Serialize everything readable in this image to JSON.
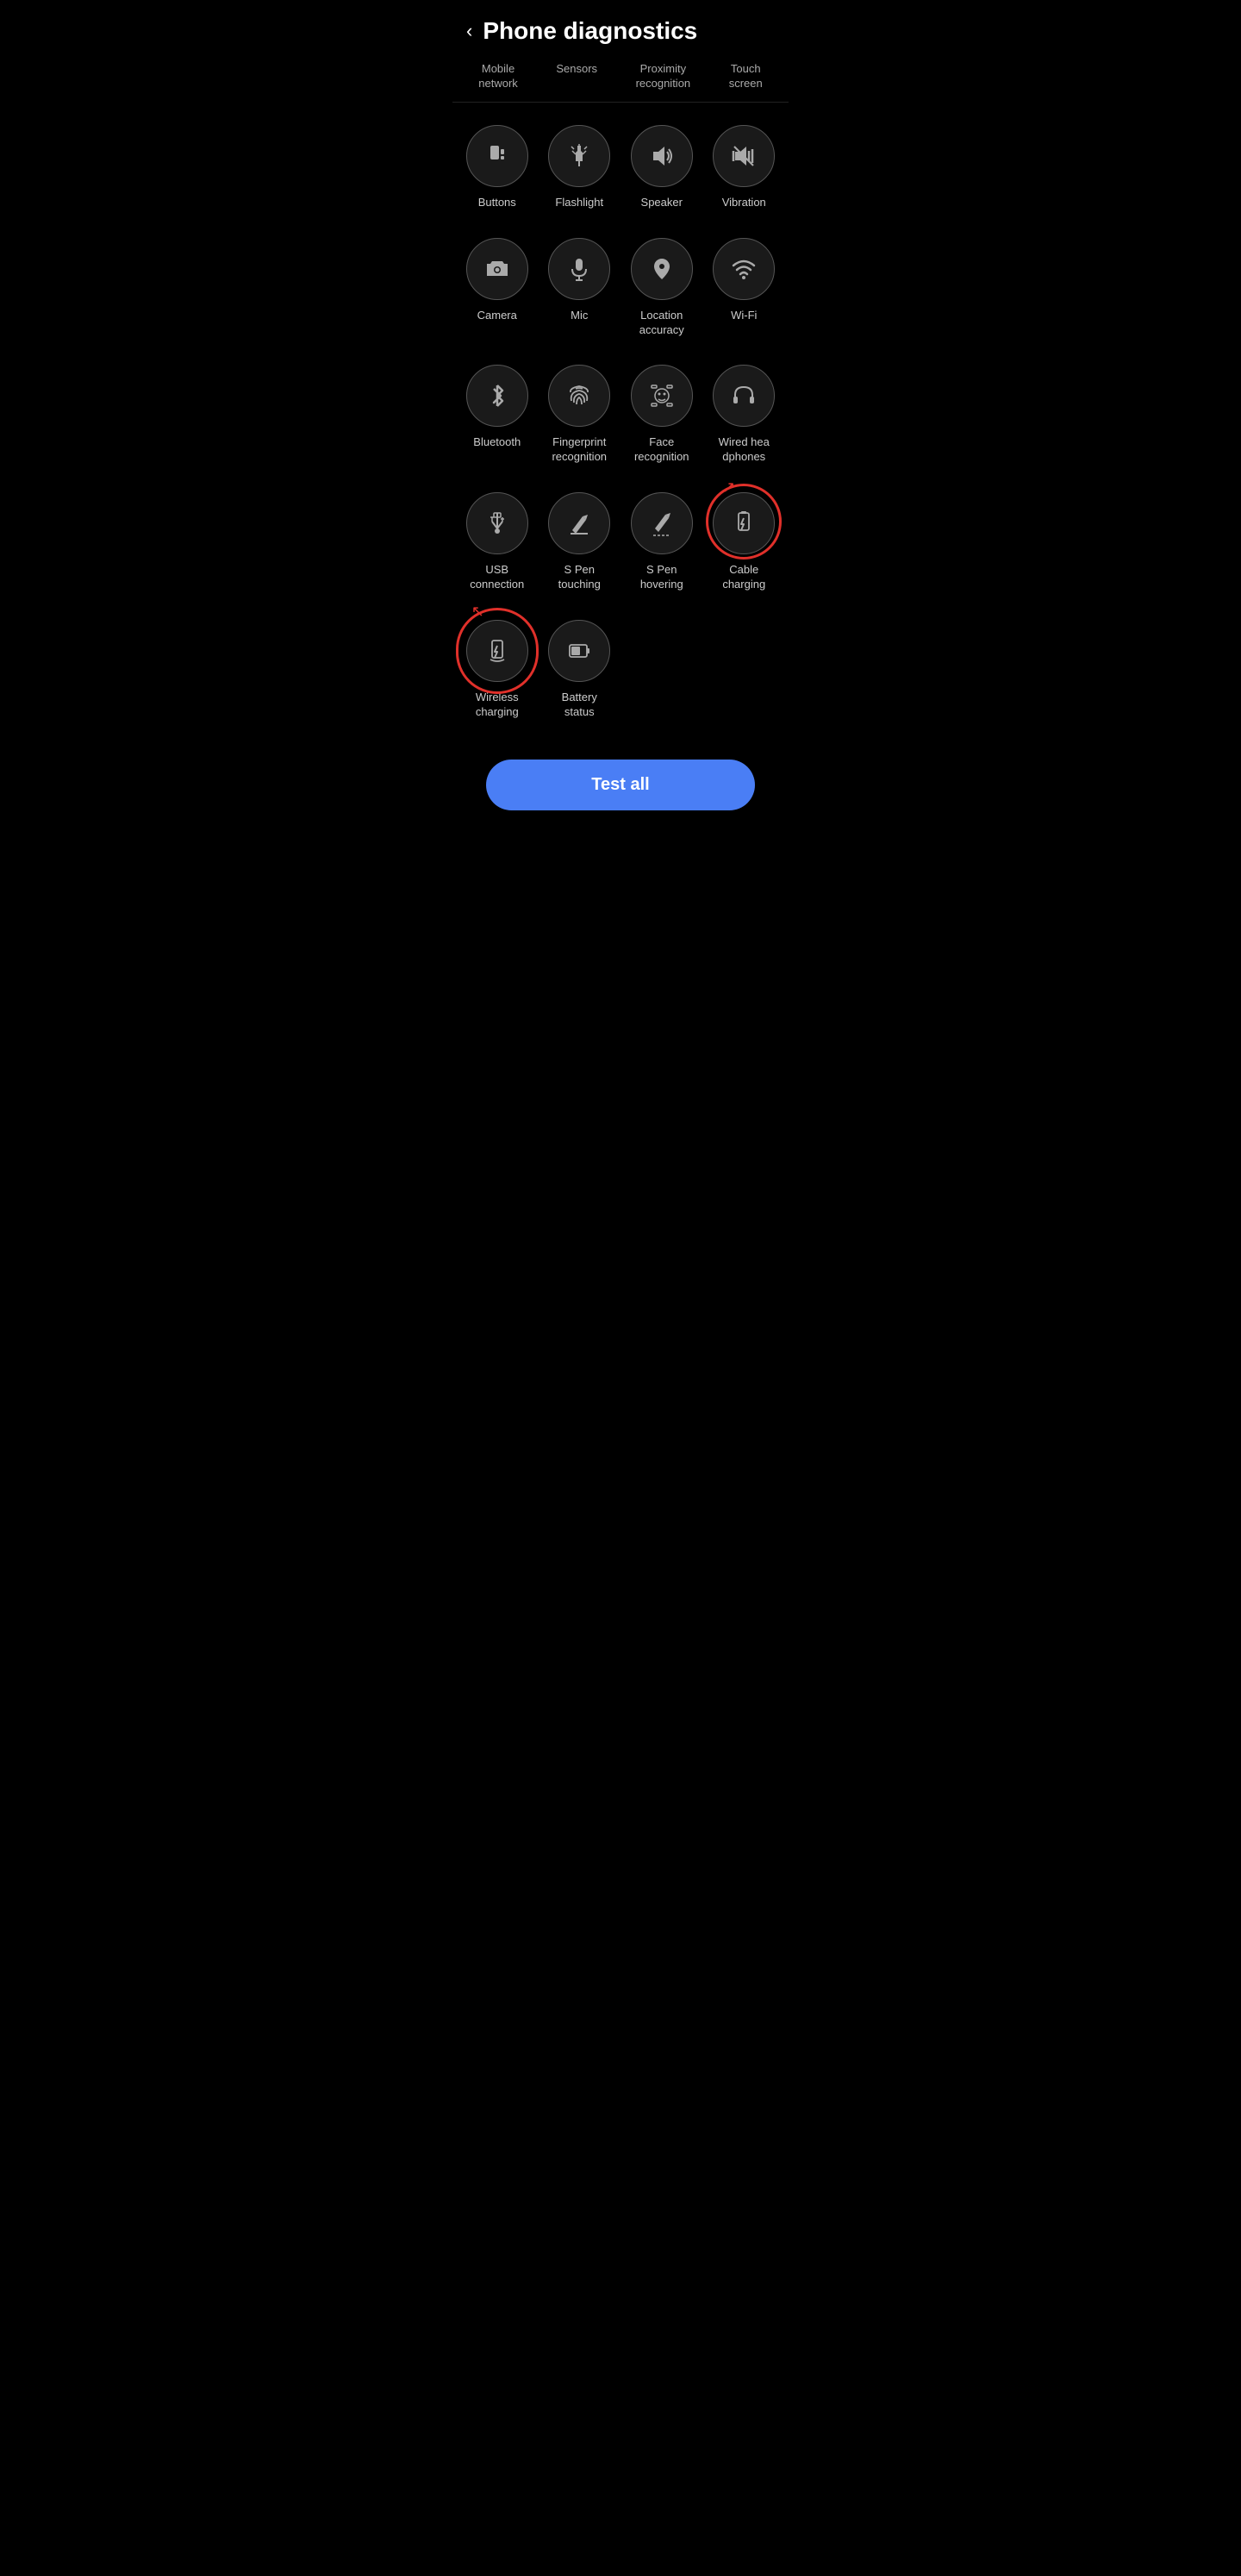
{
  "header": {
    "back_label": "‹",
    "title": "Phone diagnostics"
  },
  "top_tabs": [
    {
      "id": "mobile-network",
      "label": "Mobile\nnetwork"
    },
    {
      "id": "sensors",
      "label": "Sensors"
    },
    {
      "id": "proximity",
      "label": "Proximity\nrecognition"
    },
    {
      "id": "touch-screen",
      "label": "Touch\nscreen"
    }
  ],
  "grid_items": [
    {
      "id": "buttons",
      "label": "Buttons",
      "icon": "buttons"
    },
    {
      "id": "flashlight",
      "label": "Flashlight",
      "icon": "flashlight"
    },
    {
      "id": "speaker",
      "label": "Speaker",
      "icon": "speaker"
    },
    {
      "id": "vibration",
      "label": "Vibration",
      "icon": "vibration"
    },
    {
      "id": "camera",
      "label": "Camera",
      "icon": "camera"
    },
    {
      "id": "mic",
      "label": "Mic",
      "icon": "mic"
    },
    {
      "id": "location-accuracy",
      "label": "Location\naccuracy",
      "icon": "location"
    },
    {
      "id": "wifi",
      "label": "Wi-Fi",
      "icon": "wifi"
    },
    {
      "id": "bluetooth",
      "label": "Bluetooth",
      "icon": "bluetooth"
    },
    {
      "id": "fingerprint",
      "label": "Fingerprint\nrecognition",
      "icon": "fingerprint"
    },
    {
      "id": "face",
      "label": "Face\nrecognition",
      "icon": "face"
    },
    {
      "id": "wired-headphones",
      "label": "Wired hea\ndphones",
      "icon": "headphones"
    },
    {
      "id": "usb",
      "label": "USB\nconnection",
      "icon": "usb"
    },
    {
      "id": "spen-touching",
      "label": "S Pen\ntouching",
      "icon": "spen-touch"
    },
    {
      "id": "spen-hovering",
      "label": "S Pen\nhovering",
      "icon": "spen-hover"
    },
    {
      "id": "cable-charging",
      "label": "Cable\ncharging",
      "icon": "cable-charge",
      "annotated": true
    },
    {
      "id": "wireless-charging",
      "label": "Wireless\ncharging",
      "icon": "wireless-charge",
      "annotated": true
    },
    {
      "id": "battery-status",
      "label": "Battery\nstatus",
      "icon": "battery"
    }
  ],
  "test_all_button": "Test all",
  "colors": {
    "accent": "#4a7ef5",
    "bg": "#000",
    "icon_border": "#555",
    "icon_bg": "#1a1a1a",
    "text_primary": "#fff",
    "text_secondary": "#ccc",
    "text_tab": "#aaa",
    "annotation": "#e0302a"
  }
}
